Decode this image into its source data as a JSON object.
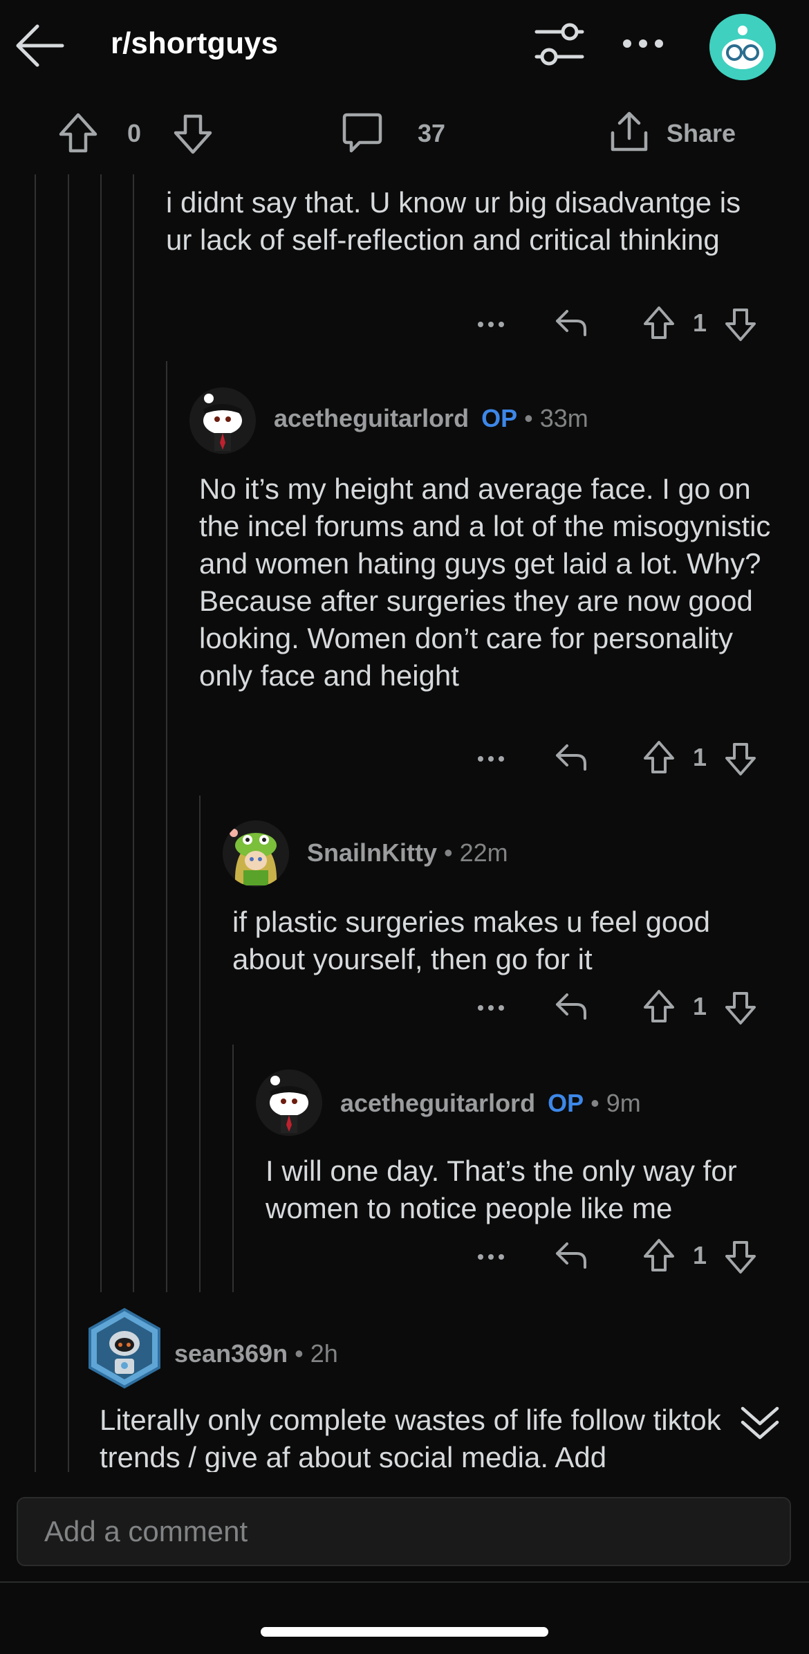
{
  "header": {
    "subreddit": "r/shortguys",
    "back_icon": "arrow-left-icon",
    "filter_icon": "sliders-icon",
    "more_icon": "ellipsis-icon"
  },
  "post_actions": {
    "vote_count": "0",
    "comment_count": "37",
    "share_label": "Share"
  },
  "comments": [
    {
      "text": "i didnt say that. U know ur big disadvantge is ur lack of self-reflection and critical thinking",
      "votes": "1"
    },
    {
      "username": "acetheguitarlord",
      "op": "OP",
      "time": "33m",
      "text": "No it’s my height and average face. I go on the incel forums and a lot of the misogynistic and women hating guys get laid a lot. Why? Because after surgeries they are now good looking. Women don’t care for personality only face and height",
      "votes": "1"
    },
    {
      "username": "SnailnKitty",
      "time": "22m",
      "text": "if plastic surgeries makes u feel good about yourself, then go for it",
      "votes": "1"
    },
    {
      "username": "acetheguitarlord",
      "op": "OP",
      "time": "9m",
      "text": "I will one day. That’s the only way for women to notice people like me",
      "votes": "1"
    },
    {
      "username": "sean369n",
      "time": "2h",
      "text": "Literally only complete wastes of life follow tiktok trends / give af about social media. Add"
    }
  ],
  "composer": {
    "placeholder": "Add a comment"
  },
  "colors": {
    "background": "#0b0b0b",
    "text": "#d7dadc",
    "muted": "#818384",
    "op_badge": "#3d87e8"
  }
}
